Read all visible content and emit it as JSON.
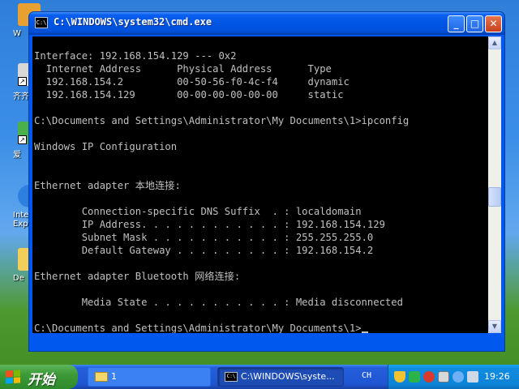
{
  "desktop": {
    "icons": [
      {
        "label": "W"
      },
      {
        "label": "齐齐"
      },
      {
        "label": "爱"
      },
      {
        "label": "Inte\nExpl"
      },
      {
        "label": "De"
      }
    ]
  },
  "window": {
    "title": "C:\\WINDOWS\\system32\\cmd.exe",
    "icon_text": "C:\\",
    "controls": {
      "minimize": "_",
      "maximize": "□",
      "close": "✕"
    },
    "lines": [
      "Interface: 192.168.154.129 --- 0x2",
      "  Internet Address      Physical Address      Type",
      "  192.168.154.2         00-50-56-f0-4c-f4     dynamic",
      "  192.168.154.129       00-00-00-00-00-00     static",
      "",
      "C:\\Documents and Settings\\Administrator\\My Documents\\1>ipconfig",
      "",
      "Windows IP Configuration",
      "",
      "",
      "Ethernet adapter 本地连接:",
      "",
      "        Connection-specific DNS Suffix  . : localdomain",
      "        IP Address. . . . . . . . . . . . : 192.168.154.129",
      "        Subnet Mask . . . . . . . . . . . : 255.255.255.0",
      "        Default Gateway . . . . . . . . . : 192.168.154.2",
      "",
      "Ethernet adapter Bluetooth 网络连接:",
      "",
      "        Media State . . . . . . . . . . . : Media disconnected",
      "",
      "C:\\Documents and Settings\\Administrator\\My Documents\\1>"
    ],
    "scroll_up": "▲",
    "scroll_down": "▼"
  },
  "taskbar": {
    "start_label": "开始",
    "tasks": [
      {
        "label": "1",
        "icon": "folder-icon"
      },
      {
        "label": "C:\\WINDOWS\\syste...",
        "icon": "cmd-icon"
      }
    ],
    "language": "CH",
    "tray_icons": [
      "shield-icon",
      "network-icon",
      "security-icon",
      "vmware-icon",
      "chat-icon",
      "volume-icon"
    ],
    "clock": "19:26"
  }
}
